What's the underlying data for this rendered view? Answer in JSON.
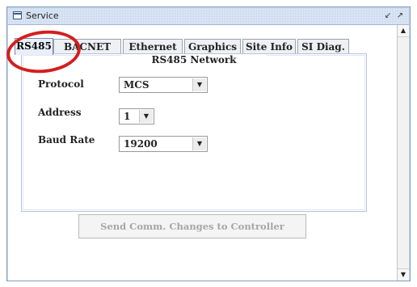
{
  "window": {
    "title": "Service",
    "min_icon": "restore-down-icon",
    "max_icon": "maximize-icon"
  },
  "tabs": [
    {
      "label": "RS485",
      "active": true
    },
    {
      "label": "BACNET",
      "active": false
    },
    {
      "label": "Ethernet",
      "active": false
    },
    {
      "label": "Graphics",
      "active": false
    },
    {
      "label": "Site Info",
      "active": false
    },
    {
      "label": "SI Diag.",
      "active": false
    }
  ],
  "panel": {
    "title": "RS485 Network",
    "fields": {
      "protocol": {
        "label": "Protocol",
        "value": "MCS"
      },
      "address": {
        "label": "Address",
        "value": "1"
      },
      "baud_rate": {
        "label": "Baud Rate",
        "value": "19200"
      }
    }
  },
  "send_button": {
    "label": "Send Comm. Changes to Controller"
  },
  "colors": {
    "accent": "#c2d3ec",
    "highlight": "#d41e1e",
    "disabled_text": "#a6a6a6"
  },
  "icons": {
    "window": "window-icon",
    "scroll_up": "scroll-up-arrow-icon",
    "scroll_down": "scroll-down-arrow-icon",
    "dropdown": "chevron-down-icon"
  }
}
